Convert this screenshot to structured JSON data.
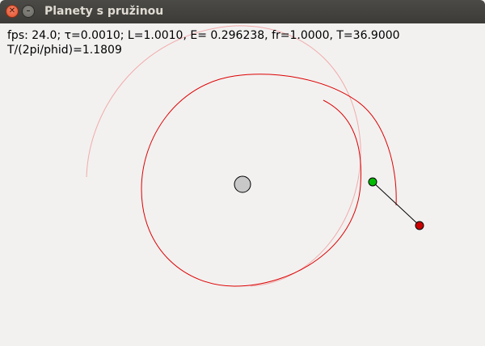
{
  "window": {
    "title": "Planety s pružinou",
    "close_glyph": "✕",
    "minimize_glyph": "–"
  },
  "info": {
    "line1": "fps: 24.0; τ=0.0010; L=1.0010, E= 0.296238, fr=1.0000, T=36.9000",
    "line2": "T/(2pi/phid)=1.1809"
  },
  "colors": {
    "trajectory": "#dd0000",
    "faint_trajectory": "#f2aaaa",
    "center_body_fill": "#c8c8c8",
    "anchor_body_fill": "#00bb00",
    "planet_fill": "#cc0000",
    "spring": "#000000",
    "background": "#f2f1f0"
  },
  "icons": {
    "close": "close-icon",
    "minimize": "minimize-icon"
  }
}
